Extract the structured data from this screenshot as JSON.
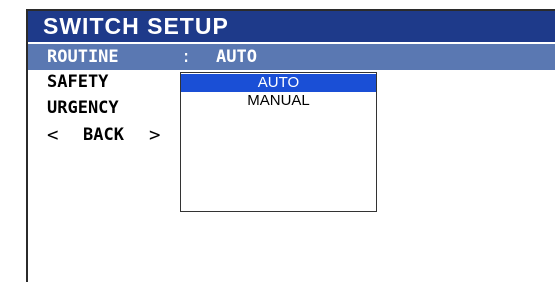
{
  "title": "SWITCH SETUP",
  "selected_row": {
    "label": "ROUTINE",
    "separator": ":",
    "value": "AUTO"
  },
  "menu_items": [
    "SAFETY",
    "URGENCY"
  ],
  "back": {
    "left_arrow": "<",
    "label": "BACK",
    "right_arrow": ">"
  },
  "dropdown": {
    "options": [
      "AUTO",
      "MANUAL"
    ],
    "selected": "AUTO"
  },
  "colors": {
    "title_bar": "#1e3a8a",
    "selected_row": "#5a78b2",
    "option_highlight": "#1a4fd6",
    "text": "#000000",
    "background": "#ffffff"
  }
}
